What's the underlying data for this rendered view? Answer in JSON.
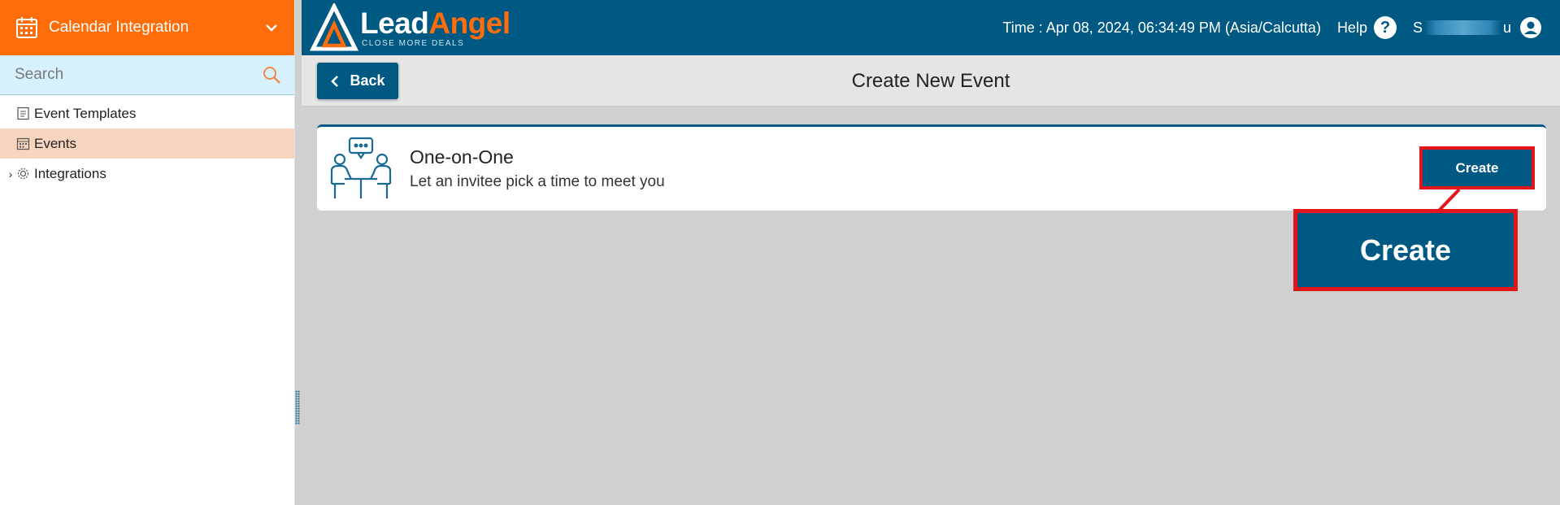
{
  "sidebar": {
    "module_title": "Calendar Integration",
    "search_placeholder": "Search",
    "items": [
      {
        "label": "Event Templates"
      },
      {
        "label": "Events"
      },
      {
        "label": "Integrations"
      }
    ]
  },
  "topbar": {
    "logo_lead": "Lead",
    "logo_angel": "Angel",
    "logo_tagline": "CLOSE MORE DEALS",
    "time": "Time : Apr 08, 2024, 06:34:49 PM (Asia/Calcutta)",
    "help_label": "Help",
    "user_first": "S",
    "user_last": "u"
  },
  "subheader": {
    "back_label": "Back",
    "title": "Create New Event"
  },
  "card": {
    "title": "One-on-One",
    "subtitle": "Let an invitee pick a time to meet you",
    "create_label": "Create"
  },
  "callout": {
    "label": "Create"
  },
  "colors": {
    "brand_blue": "#005983",
    "brand_orange": "#ff6d0a",
    "highlight_red": "#e4141b",
    "active_row": "#f7d4bd"
  }
}
